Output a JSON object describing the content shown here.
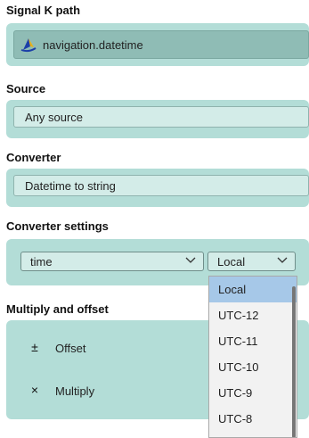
{
  "signalk": {
    "title": "Signal K path",
    "path_value": "navigation.datetime",
    "path_icon": "signalk-logo-icon"
  },
  "source": {
    "title": "Source",
    "value": "Any source"
  },
  "converter": {
    "title": "Converter",
    "value": "Datetime to string"
  },
  "converter_settings": {
    "title": "Converter settings",
    "format_value": "time",
    "timezone_value": "Local",
    "timezone_options": [
      "Local",
      "UTC-12",
      "UTC-11",
      "UTC-10",
      "UTC-9",
      "UTC-8"
    ],
    "selected_option": "Local"
  },
  "multiply_offset": {
    "title": "Multiply and offset",
    "offset_label": "Offset",
    "offset_icon": "plus-minus-icon",
    "offset_symbol": "±",
    "multiply_label": "Multiply",
    "multiply_icon": "times-icon",
    "multiply_symbol": "×"
  },
  "colors": {
    "panel": "#b3ddd7",
    "field": "#d3ece8",
    "dropdown_selected": "#a6c8e8"
  }
}
